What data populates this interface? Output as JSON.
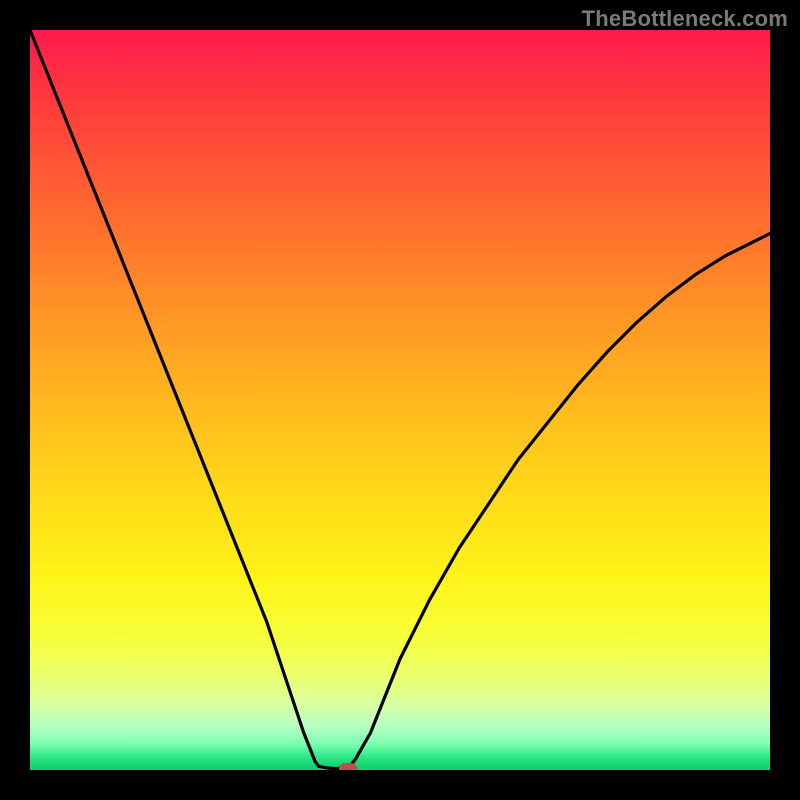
{
  "watermark": "TheBottleneck.com",
  "colors": {
    "frame": "#000000",
    "curve": "#000000",
    "marker": "#c24b4b",
    "gradient_stops": [
      "#ff1a4d",
      "#ff3c3c",
      "#ff6a2f",
      "#ff9426",
      "#ffb71f",
      "#ffd81a",
      "#fff318",
      "#f6ff3a",
      "#ecff6a",
      "#d9ffa0",
      "#b7ffc4",
      "#7affb0",
      "#30e88a",
      "#18d878",
      "#0fd072"
    ]
  },
  "chart_data": {
    "type": "line",
    "title": "",
    "xlabel": "",
    "ylabel": "",
    "xlim": [
      0,
      100
    ],
    "ylim": [
      0,
      100
    ],
    "grid": false,
    "legend": false,
    "annotations": [
      {
        "text": "TheBottleneck.com",
        "pos": "top-right"
      }
    ],
    "series": [
      {
        "name": "left-branch",
        "x": [
          0,
          4,
          8,
          12,
          16,
          20,
          24,
          28,
          32,
          34,
          36,
          37,
          38,
          38.5,
          39
        ],
        "y": [
          100,
          90,
          80,
          70,
          60,
          50,
          40,
          30,
          20,
          14,
          8,
          5,
          2.5,
          1.2,
          0.5
        ]
      },
      {
        "name": "flat-bottom",
        "x": [
          39,
          40,
          41,
          42,
          43
        ],
        "y": [
          0.5,
          0.3,
          0.2,
          0.2,
          0.2
        ]
      },
      {
        "name": "right-branch",
        "x": [
          43,
          44,
          46,
          48,
          50,
          54,
          58,
          62,
          66,
          70,
          74,
          78,
          82,
          86,
          90,
          94,
          98,
          100
        ],
        "y": [
          0.2,
          1.5,
          5,
          10,
          15,
          23,
          30,
          36,
          42,
          47,
          52,
          56.5,
          60.5,
          64,
          67,
          69.5,
          71.5,
          72.5
        ]
      }
    ],
    "marker": {
      "x": 43,
      "y": 0.2,
      "shape": "rounded-rect",
      "color": "#c24b4b"
    }
  }
}
